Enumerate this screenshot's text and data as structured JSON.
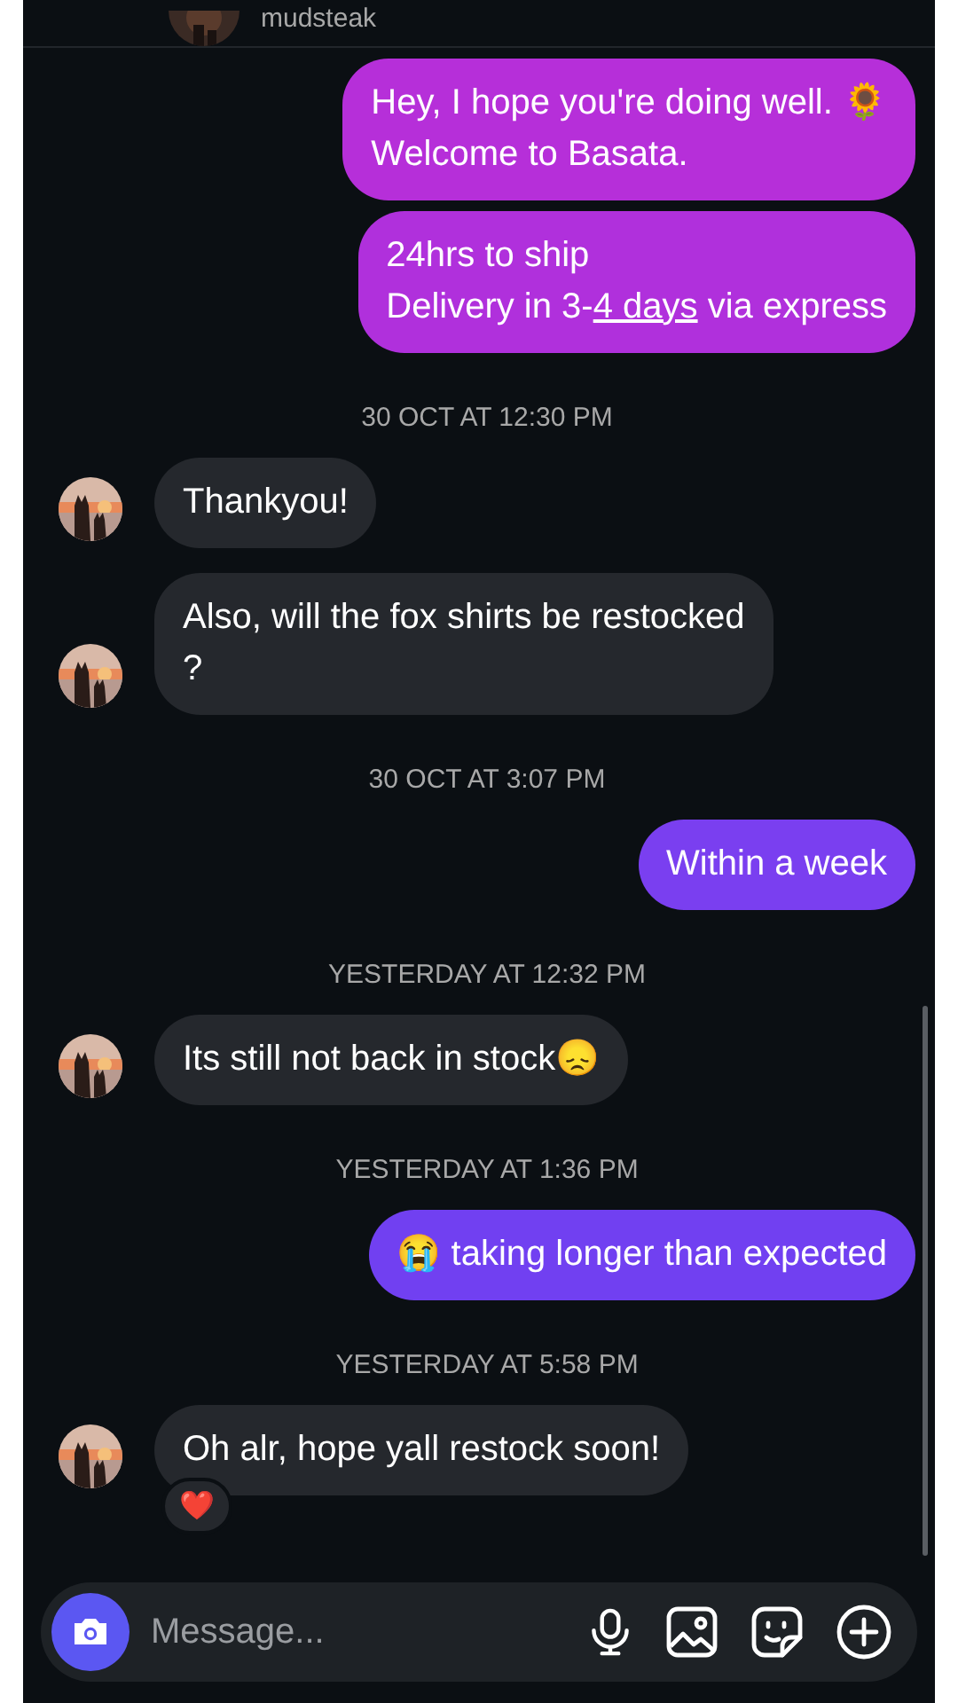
{
  "header": {
    "username": "mudsteak"
  },
  "messages": [
    {
      "kind": "sent",
      "color": "#b62fd9",
      "parts": [
        {
          "text": "Hey, I hope you're doing well. 🌻\nWelcome to Basata."
        }
      ]
    },
    {
      "kind": "sent",
      "color": "#b030dc",
      "parts": [
        {
          "text": "24hrs to ship\nDelivery in 3-"
        },
        {
          "text": "4 days",
          "kind": "link"
        },
        {
          "text": " via express"
        }
      ]
    },
    {
      "kind": "timestamp",
      "text": "30 OCT AT 12:30 PM"
    },
    {
      "kind": "received",
      "parts": [
        {
          "text": "Thankyou!"
        }
      ]
    },
    {
      "kind": "received",
      "parts": [
        {
          "text": "Also, will the fox shirts be restocked\n?"
        }
      ]
    },
    {
      "kind": "timestamp",
      "text": "30 OCT AT 3:07 PM"
    },
    {
      "kind": "sent",
      "color": "#7a3ff0",
      "parts": [
        {
          "text": "Within a week"
        }
      ]
    },
    {
      "kind": "timestamp",
      "text": "YESTERDAY AT 12:32 PM"
    },
    {
      "kind": "received",
      "parts": [
        {
          "text": "Its still not back in stock😞"
        }
      ]
    },
    {
      "kind": "timestamp",
      "text": "YESTERDAY AT 1:36 PM"
    },
    {
      "kind": "sent",
      "color": "#7140f1",
      "parts": [
        {
          "text": "😭 taking longer than expected"
        }
      ]
    },
    {
      "kind": "timestamp",
      "text": "YESTERDAY AT 5:58 PM"
    },
    {
      "kind": "received",
      "parts": [
        {
          "text": "Oh alr, hope yall restock soon!"
        }
      ],
      "reaction": "❤️"
    }
  ],
  "composer": {
    "placeholder": "Message..."
  }
}
